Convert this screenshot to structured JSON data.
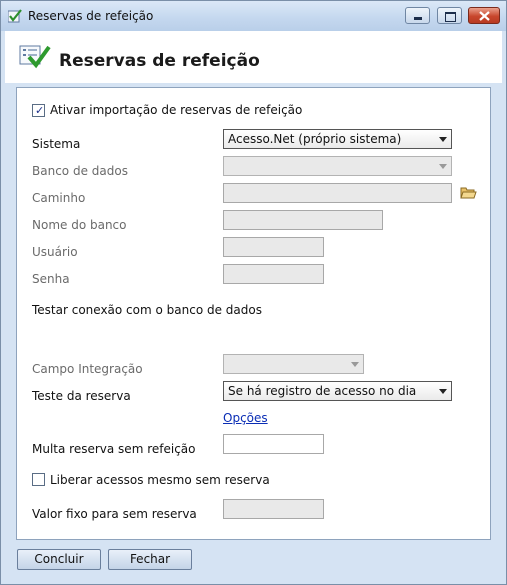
{
  "window": {
    "title": "Reservas de refeição"
  },
  "header": {
    "title": "Reservas de refeição"
  },
  "form": {
    "enable_import": {
      "label": "Ativar importação de reservas de refeição",
      "checked": true
    },
    "sistema": {
      "label": "Sistema",
      "value": "Acesso.Net (próprio sistema)"
    },
    "banco_dados": {
      "label": "Banco de dados",
      "value": ""
    },
    "caminho": {
      "label": "Caminho",
      "value": ""
    },
    "nome_banco": {
      "label": "Nome do banco",
      "value": ""
    },
    "usuario": {
      "label": "Usuário",
      "value": ""
    },
    "senha": {
      "label": "Senha",
      "value": ""
    },
    "testar_conexao": {
      "label": "Testar conexão com o banco de dados"
    },
    "campo_integracao": {
      "label": "Campo Integração",
      "value": ""
    },
    "teste_reserva": {
      "label": "Teste da reserva",
      "value": "Se há registro de acesso no dia"
    },
    "opcoes_link": "Opções",
    "multa": {
      "label": "Multa reserva sem refeição",
      "value": ""
    },
    "liberar": {
      "label": "Liberar acessos mesmo sem reserva",
      "checked": false
    },
    "valor_fixo": {
      "label": "Valor fixo para sem reserva",
      "value": ""
    }
  },
  "buttons": {
    "concluir": "Concluir",
    "fechar": "Fechar"
  },
  "icons": {
    "window": "checklist-icon",
    "header": "checklist-icon",
    "folder": "folder-icon"
  }
}
